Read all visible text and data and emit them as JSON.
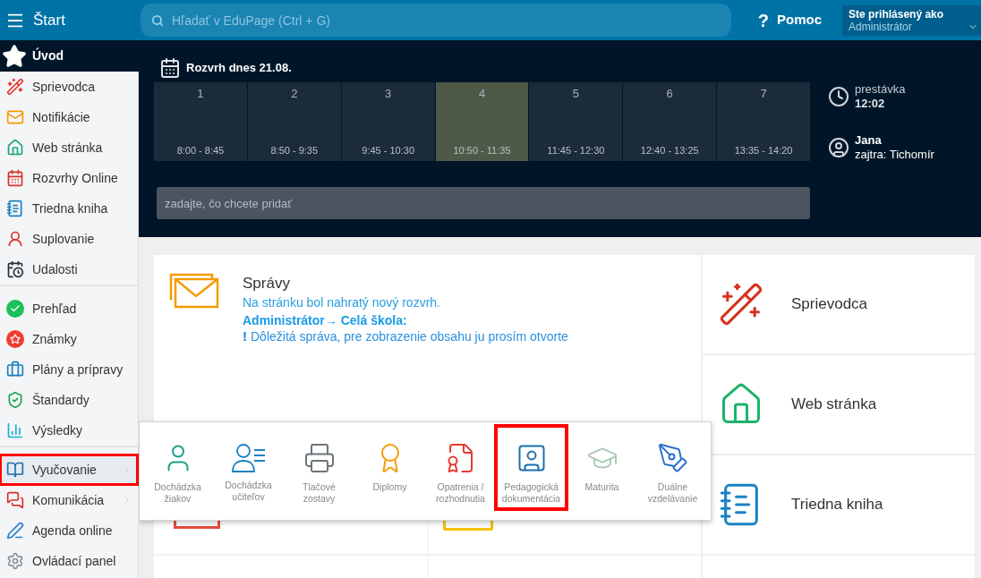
{
  "topbar": {
    "title": "Štart",
    "search": {
      "placeholder": "Hľadať v EduPage (Ctrl + G)"
    },
    "help": {
      "mark": "?",
      "label": "Pomoc"
    },
    "account": {
      "caption": "Ste prihlásený ako",
      "name": "Administrátor"
    }
  },
  "sidebar": {
    "home": "Úvod",
    "groups": [
      {
        "items": [
          {
            "kind": "wizard",
            "label": "Sprievodca",
            "selected": false,
            "highlighted": false,
            "has_submenu": false
          },
          {
            "kind": "notifications",
            "label": "Notifikácie",
            "selected": false,
            "highlighted": false,
            "has_submenu": false
          },
          {
            "kind": "website",
            "label": "Web stránka",
            "selected": false,
            "highlighted": false,
            "has_submenu": false
          },
          {
            "kind": "timetable",
            "label": "Rozvrhy Online",
            "selected": false,
            "highlighted": false,
            "has_submenu": false
          },
          {
            "kind": "classbook",
            "label": "Triedna kniha",
            "selected": false,
            "highlighted": false,
            "has_submenu": false
          },
          {
            "kind": "substitution",
            "label": "Suplovanie",
            "selected": false,
            "highlighted": false,
            "has_submenu": false
          },
          {
            "kind": "events",
            "label": "Udalosti",
            "selected": false,
            "highlighted": false,
            "has_submenu": false
          }
        ]
      },
      {
        "items": [
          {
            "kind": "overview",
            "label": "Prehľad",
            "selected": false,
            "highlighted": false,
            "has_submenu": false
          },
          {
            "kind": "grades",
            "label": "Známky",
            "selected": false,
            "highlighted": false,
            "has_submenu": false
          },
          {
            "kind": "plans",
            "label": "Plány a prípravy",
            "selected": false,
            "highlighted": false,
            "has_submenu": false
          },
          {
            "kind": "standards",
            "label": "Štandardy",
            "selected": false,
            "highlighted": false,
            "has_submenu": false
          },
          {
            "kind": "results",
            "label": "Výsledky",
            "selected": false,
            "highlighted": false,
            "has_submenu": false
          }
        ]
      },
      {
        "items": [
          {
            "kind": "teaching",
            "label": "Vyučovanie",
            "selected": true,
            "highlighted": true,
            "has_submenu": true
          },
          {
            "kind": "communication",
            "label": "Komunikácia",
            "selected": false,
            "highlighted": false,
            "has_submenu": true
          },
          {
            "kind": "agenda",
            "label": "Agenda online",
            "selected": false,
            "highlighted": false,
            "has_submenu": false
          },
          {
            "kind": "settings",
            "label": "Ovládací panel",
            "selected": false,
            "highlighted": false,
            "has_submenu": false
          }
        ]
      }
    ]
  },
  "timetable": {
    "title": "Rozvrh dnes 21.08.",
    "lessons": [
      {
        "number": "1",
        "time": "8:00 - 8:45",
        "selected": false
      },
      {
        "number": "2",
        "time": "8:50 - 9:35",
        "selected": false
      },
      {
        "number": "3",
        "time": "9:45 - 10:30",
        "selected": false
      },
      {
        "number": "4",
        "time": "10:50 - 11:35",
        "selected": true
      },
      {
        "number": "5",
        "time": "11:45 - 12:30",
        "selected": false
      },
      {
        "number": "6",
        "time": "12:40 - 13:25",
        "selected": false
      },
      {
        "number": "7",
        "time": "13:35 - 14:20",
        "selected": false
      }
    ],
    "status": {
      "label": "prestávka",
      "time": "12:02"
    },
    "duty": {
      "name": "Jana",
      "tomorrow": "zajtra: Tichomír"
    },
    "add_field": {
      "placeholder": "zadajte, čo chcete pridať"
    }
  },
  "messages": {
    "title": "Správy",
    "line": "Na stránku bol nahratý nový rozvrh.",
    "sender": "Administrátor→ Celá škola:",
    "important_mark": "!",
    "important": "Dôležitá správa, pre zobrazenie obsahu ju prosím otvorte"
  },
  "tiles": [
    {
      "kind": "wizard",
      "label": "Sprievodca"
    },
    {
      "kind": "website",
      "label": "Web stránka"
    },
    {
      "kind": "classbook",
      "label": "Triedna kniha"
    }
  ],
  "submenu": [
    {
      "kind": "students",
      "label": "Dochádzka žiakov",
      "highlighted": false
    },
    {
      "kind": "teachers",
      "label": "Dochádzka učiteľov",
      "highlighted": false
    },
    {
      "kind": "reports",
      "label": "Tlačové zostavy",
      "highlighted": false
    },
    {
      "kind": "diplomas",
      "label": "Diplomy",
      "highlighted": false
    },
    {
      "kind": "decisions",
      "label": "Opatrenia / rozhodnutia",
      "highlighted": false
    },
    {
      "kind": "documentation",
      "label": "Pedagogická dokumentácia",
      "highlighted": true
    },
    {
      "kind": "graduation",
      "label": "Maturita",
      "highlighted": false
    },
    {
      "kind": "dual",
      "label": "Duálne vzdelávanie",
      "highlighted": false
    }
  ]
}
